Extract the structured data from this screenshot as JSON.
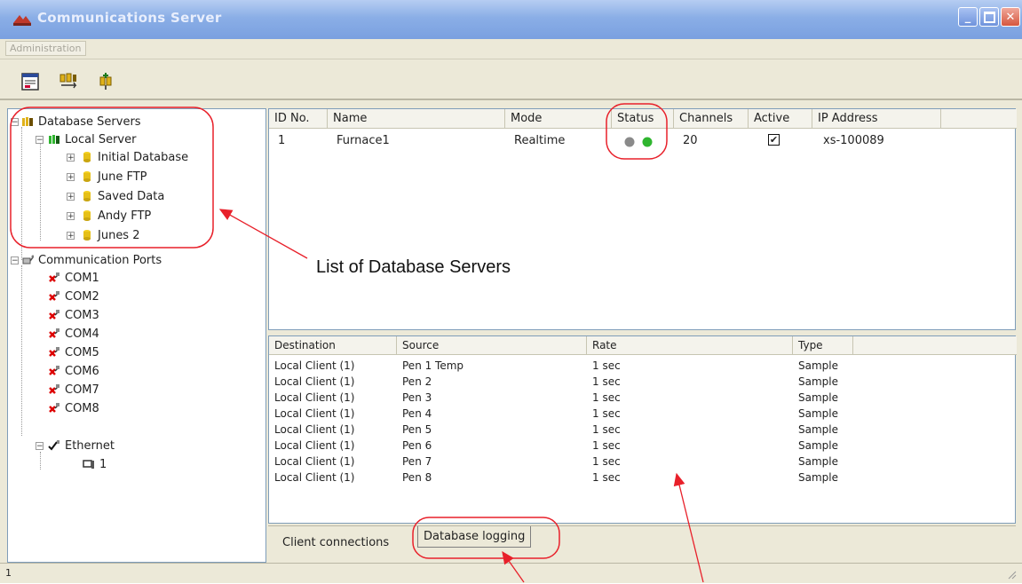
{
  "window": {
    "title": "Communications Server"
  },
  "menu": {
    "items": [
      "Administration"
    ]
  },
  "toolbar": {
    "icons": [
      "report-icon",
      "server-connect-icon",
      "server-add-icon"
    ]
  },
  "tree": {
    "items": [
      {
        "label": "Database Servers",
        "icon": "database-servers-icon"
      },
      {
        "label": "Local Server",
        "icon": "server-icon"
      },
      {
        "label": "Initial Database",
        "icon": "database-icon"
      },
      {
        "label": "June FTP",
        "icon": "database-icon"
      },
      {
        "label": "Saved Data",
        "icon": "database-icon"
      },
      {
        "label": "Andy FTP",
        "icon": "database-icon"
      },
      {
        "label": "Junes 2",
        "icon": "database-icon"
      },
      {
        "label": "Communication Ports",
        "icon": "ports-icon"
      },
      {
        "label": "COM1",
        "icon": "com-port-error-icon"
      },
      {
        "label": "COM2",
        "icon": "com-port-error-icon"
      },
      {
        "label": "COM3",
        "icon": "com-port-error-icon"
      },
      {
        "label": "COM4",
        "icon": "com-port-error-icon"
      },
      {
        "label": "COM5",
        "icon": "com-port-error-icon"
      },
      {
        "label": "COM6",
        "icon": "com-port-error-icon"
      },
      {
        "label": "COM7",
        "icon": "com-port-error-icon"
      },
      {
        "label": "COM8",
        "icon": "com-port-error-icon"
      },
      {
        "label": "Ethernet",
        "icon": "ethernet-ok-icon"
      },
      {
        "label": "1",
        "icon": "network-device-icon"
      }
    ]
  },
  "servers_table": {
    "headers": [
      "ID No.",
      "Name",
      "Mode",
      "Status",
      "Channels",
      "Active",
      "IP Address"
    ],
    "rows": [
      {
        "id": "1",
        "name": "Furnace1",
        "mode": "Realtime",
        "status": [
          "grey",
          "green"
        ],
        "channels": "20",
        "active": true,
        "ip": "xs-100089"
      }
    ]
  },
  "logging_table": {
    "headers": [
      "Destination",
      "Source",
      "Rate",
      "Type"
    ],
    "rows": [
      [
        "Local Client (1)",
        "Pen 1 Temp",
        "1 sec",
        "Sample"
      ],
      [
        "Local Client (1)",
        "Pen 2",
        "1 sec",
        "Sample"
      ],
      [
        "Local Client (1)",
        "Pen 3",
        "1 sec",
        "Sample"
      ],
      [
        "Local Client (1)",
        "Pen 4",
        "1 sec",
        "Sample"
      ],
      [
        "Local Client (1)",
        "Pen 5",
        "1 sec",
        "Sample"
      ],
      [
        "Local Client (1)",
        "Pen 6",
        "1 sec",
        "Sample"
      ],
      [
        "Local Client (1)",
        "Pen 7",
        "1 sec",
        "Sample"
      ],
      [
        "Local Client (1)",
        "Pen 8",
        "1 sec",
        "Sample"
      ]
    ]
  },
  "tabs": [
    "Client connections",
    "Database logging"
  ],
  "annotations": {
    "list_label": "List of Database Servers"
  },
  "statusbar": {
    "text": "1"
  },
  "colors": {
    "annotation": "#e8202a",
    "status_ok": "#2fb52f",
    "status_idle": "#8a8a8a"
  }
}
